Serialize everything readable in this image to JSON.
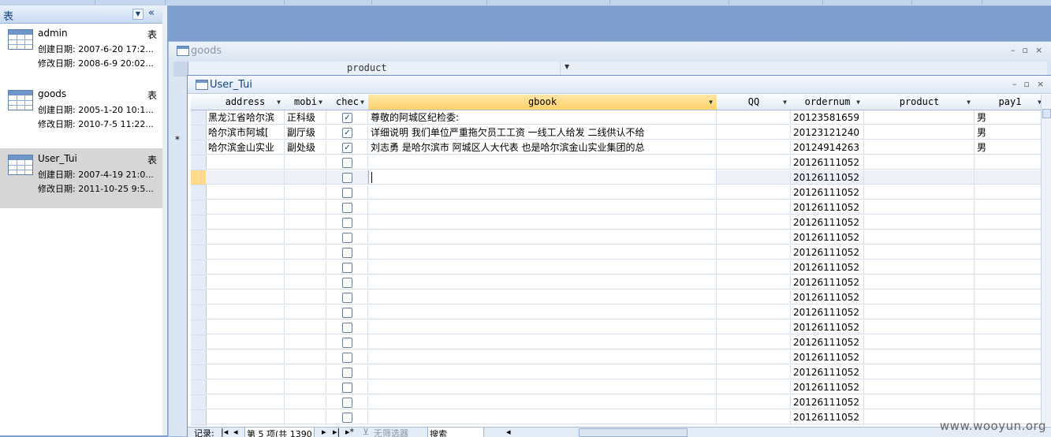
{
  "nav": {
    "title": "表",
    "items": [
      {
        "name": "admin",
        "kind": "表",
        "created": "创建日期: 2007-6-20 17:2...",
        "modified": "修改日期: 2008-6-9 20:02...",
        "selected": false
      },
      {
        "name": "goods",
        "kind": "表",
        "created": "创建日期: 2005-1-20 10:1...",
        "modified": "修改日期: 2010-7-5 11:22...",
        "selected": false
      },
      {
        "name": "User_Tui",
        "kind": "表",
        "created": "创建日期: 2007-4-19 21:0...",
        "modified": "修改日期: 2011-10-25 9:5...",
        "selected": true
      }
    ]
  },
  "goods_window": {
    "title": "goods",
    "column": "product",
    "new_row_marker": "*"
  },
  "user_window": {
    "title": "User_Tui",
    "columns": [
      "address",
      "mobi",
      "chec",
      "gbook",
      "QQ",
      "ordernum",
      "product",
      "pay1"
    ],
    "active_column": "gbook",
    "rows": [
      {
        "address": "黑龙江省哈尔滨",
        "mobi": "正科级",
        "checked": true,
        "gbook": "尊敬的阿城区纪检委:",
        "QQ": "",
        "ordernum": "20123581659",
        "product": "",
        "pay1": "男"
      },
      {
        "address": "哈尔滨市阿城[",
        "mobi": "副厅级",
        "checked": true,
        "gbook": "详细说明 我们单位严重拖欠员工工资 一线工人给发 二线供认不给",
        "QQ": "",
        "ordernum": "20123121240",
        "product": "",
        "pay1": "男"
      },
      {
        "address": "哈尔滨金山实业",
        "mobi": "副处级",
        "checked": true,
        "gbook": "刘志勇 是哈尔滨市 阿城区人大代表 也是哈尔滨金山实业集团的总",
        "QQ": "",
        "ordernum": "20124914263",
        "product": "",
        "pay1": "男"
      },
      {
        "address": "",
        "mobi": "",
        "checked": false,
        "gbook": "",
        "QQ": "",
        "ordernum": "20126111052",
        "product": "",
        "pay1": ""
      },
      {
        "address": "",
        "mobi": "",
        "checked": false,
        "gbook": "",
        "QQ": "",
        "ordernum": "20126111052",
        "product": "",
        "pay1": "",
        "current": true
      },
      {
        "address": "",
        "mobi": "",
        "checked": false,
        "gbook": "",
        "QQ": "",
        "ordernum": "20126111052",
        "product": "",
        "pay1": ""
      },
      {
        "address": "",
        "mobi": "",
        "checked": false,
        "gbook": "",
        "QQ": "",
        "ordernum": "20126111052",
        "product": "",
        "pay1": ""
      },
      {
        "address": "",
        "mobi": "",
        "checked": false,
        "gbook": "",
        "QQ": "",
        "ordernum": "20126111052",
        "product": "",
        "pay1": ""
      },
      {
        "address": "",
        "mobi": "",
        "checked": false,
        "gbook": "",
        "QQ": "",
        "ordernum": "20126111052",
        "product": "",
        "pay1": ""
      },
      {
        "address": "",
        "mobi": "",
        "checked": false,
        "gbook": "",
        "QQ": "",
        "ordernum": "20126111052",
        "product": "",
        "pay1": ""
      },
      {
        "address": "",
        "mobi": "",
        "checked": false,
        "gbook": "",
        "QQ": "",
        "ordernum": "20126111052",
        "product": "",
        "pay1": ""
      },
      {
        "address": "",
        "mobi": "",
        "checked": false,
        "gbook": "",
        "QQ": "",
        "ordernum": "20126111052",
        "product": "",
        "pay1": ""
      },
      {
        "address": "",
        "mobi": "",
        "checked": false,
        "gbook": "",
        "QQ": "",
        "ordernum": "20126111052",
        "product": "",
        "pay1": ""
      },
      {
        "address": "",
        "mobi": "",
        "checked": false,
        "gbook": "",
        "QQ": "",
        "ordernum": "20126111052",
        "product": "",
        "pay1": ""
      },
      {
        "address": "",
        "mobi": "",
        "checked": false,
        "gbook": "",
        "QQ": "",
        "ordernum": "20126111052",
        "product": "",
        "pay1": ""
      },
      {
        "address": "",
        "mobi": "",
        "checked": false,
        "gbook": "",
        "QQ": "",
        "ordernum": "20126111052",
        "product": "",
        "pay1": ""
      },
      {
        "address": "",
        "mobi": "",
        "checked": false,
        "gbook": "",
        "QQ": "",
        "ordernum": "20126111052",
        "product": "",
        "pay1": ""
      },
      {
        "address": "",
        "mobi": "",
        "checked": false,
        "gbook": "",
        "QQ": "",
        "ordernum": "20126111052",
        "product": "",
        "pay1": ""
      },
      {
        "address": "",
        "mobi": "",
        "checked": false,
        "gbook": "",
        "QQ": "",
        "ordernum": "20126111052",
        "product": "",
        "pay1": ""
      },
      {
        "address": "",
        "mobi": "",
        "checked": false,
        "gbook": "",
        "QQ": "",
        "ordernum": "20126111052",
        "product": "",
        "pay1": ""
      },
      {
        "address": "",
        "mobi": "",
        "checked": false,
        "gbook": "",
        "QQ": "",
        "ordernum": "20126111052",
        "product": "",
        "pay1": ""
      },
      {
        "address": "",
        "mobi": "",
        "checked": false,
        "gbook": "",
        "QQ": "",
        "ordernum": "20126111052",
        "product": "",
        "pay1": ""
      }
    ],
    "status": {
      "record_label": "记录:",
      "record_position": "第 5 项(共 1390",
      "filter_label": "无筛选器",
      "search_placeholder": "搜索"
    }
  },
  "watermark": "www.wooyun.org",
  "colors": {
    "accent": "#ffd26b",
    "nav_selected": "#d6d6d6",
    "frame": "#7f9fcf"
  }
}
